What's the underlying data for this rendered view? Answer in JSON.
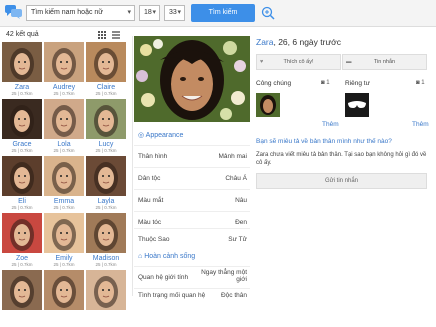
{
  "search": {
    "gender_value": "Tìm kiếm nam hoặc nữ",
    "age_min": "18",
    "age_max": "33",
    "button_label": "Tìm kiếm"
  },
  "results": {
    "count_label": "42 kết quả",
    "people": [
      {
        "name": "Zara",
        "meta": "25 | 0.7km",
        "tone": "#7a5d43"
      },
      {
        "name": "Audrey",
        "meta": "25 | 0.7km",
        "tone": "#c9a27e"
      },
      {
        "name": "Claire",
        "meta": "25 | 0.7km",
        "tone": "#b98a5d"
      },
      {
        "name": "Grace",
        "meta": "25 | 0.7km",
        "tone": "#3a2a20"
      },
      {
        "name": "Lola",
        "meta": "25 | 0.7km",
        "tone": "#d0a98a"
      },
      {
        "name": "Lucy",
        "meta": "25 | 0.7km",
        "tone": "#8e9a6a"
      },
      {
        "name": "Eli",
        "meta": "25 | 0.7km",
        "tone": "#5c3e2c"
      },
      {
        "name": "Emma",
        "meta": "25 | 0.7km",
        "tone": "#d9b38c"
      },
      {
        "name": "Layla",
        "meta": "25 | 0.7km",
        "tone": "#6b4a36"
      },
      {
        "name": "Zoe",
        "meta": "25 | 0.7km",
        "tone": "#c94840"
      },
      {
        "name": "Emily",
        "meta": "25 | 0.7km",
        "tone": "#e7c39b"
      },
      {
        "name": "Madison",
        "meta": "25 | 0.7km",
        "tone": "#a07a58"
      },
      {
        "name": "",
        "meta": "",
        "tone": "#8a6a50"
      },
      {
        "name": "",
        "meta": "",
        "tone": "#b58c69"
      },
      {
        "name": "",
        "meta": "",
        "tone": "#d7b597"
      }
    ]
  },
  "profile": {
    "name": "Zara",
    "title_rest": ", 26, 6 ngày trước",
    "like_label": "Thích cô ấy!",
    "message_label": "Tin nhắn",
    "public_label": "Công chúng",
    "public_count": "1",
    "private_label": "Riêng tư",
    "private_count": "1",
    "more_public": "Thêm",
    "more_private": "Thêm",
    "ask_link": "Bạn sẽ miêu tả về bản thân mình như thế nào?",
    "ask_text": "Zara chưa viết miêu tả bản thân. Tại sao bạn không hỏi gì đó về cô ấy.",
    "send_message": "Gửi tin nhắn",
    "appearance_heading": "Appearance",
    "attributes": [
      {
        "key": "Thân hình",
        "value": "Mảnh mai"
      },
      {
        "key": "Dân tộc",
        "value": "Châu Á"
      },
      {
        "key": "Màu mắt",
        "value": "Nâu"
      },
      {
        "key": "Màu tóc",
        "value": "Đen"
      },
      {
        "key": "Thuộc Sao",
        "value": "Sư Tử"
      }
    ],
    "lifestyle_heading": "Hoàn cảnh sống",
    "lifestyle": [
      {
        "key": "Quan hệ giới tính",
        "value": "Ngay thẳng một giới"
      },
      {
        "key": "Tình trạng mối quan hệ",
        "value": "Độc thân"
      }
    ]
  },
  "colors": {
    "accent": "#3d8fe8",
    "link": "#3a78c9"
  }
}
